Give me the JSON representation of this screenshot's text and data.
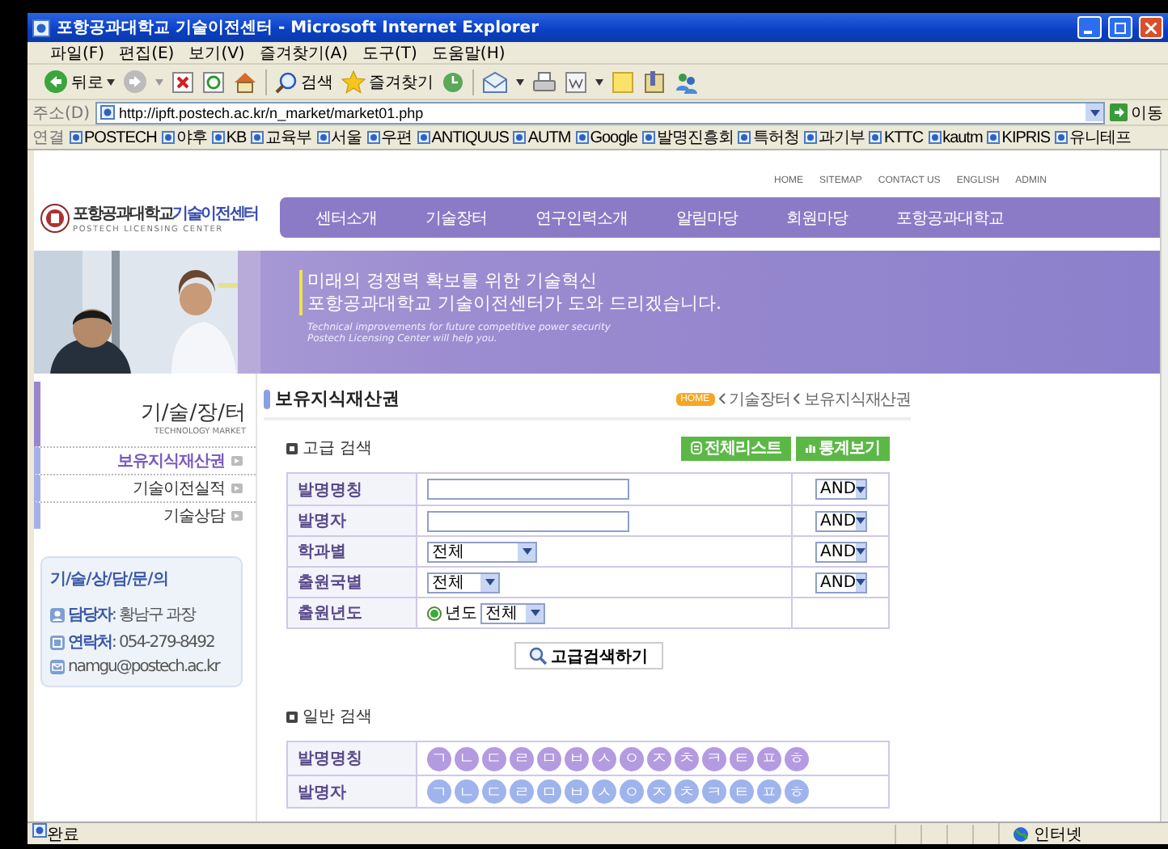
{
  "window": {
    "title": "포항공과대학교 기술이전센터 - Microsoft Internet Explorer"
  },
  "menu": [
    "파일(F)",
    "편집(E)",
    "보기(V)",
    "즐겨찾기(A)",
    "도구(T)",
    "도움말(H)"
  ],
  "toolbar": {
    "back": "뒤로",
    "search": "검색",
    "favorites": "즐겨찾기"
  },
  "address": {
    "label": "주소(D)",
    "url": "http://ipft.postech.ac.kr/n_market/market01.php",
    "go": "이동"
  },
  "links": {
    "label": "연결",
    "items": [
      "POSTECH",
      "야후",
      "KB",
      "교육부",
      "서울",
      "우편",
      "ANTIQUUS",
      "AUTM",
      "Google",
      "발명진흥회",
      "특허청",
      "과기부",
      "KTTC",
      "kautm",
      "KIPRIS",
      "유니테프"
    ]
  },
  "page": {
    "top_links": [
      "HOME",
      "SITEMAP",
      "CONTACT US",
      "ENGLISH",
      "ADMIN"
    ],
    "logo": {
      "name": "포항공과대학교",
      "accent": "기술이전센터",
      "subtitle": "POSTECH LICENSING CENTER"
    },
    "nav": [
      "센터소개",
      "기술장터",
      "연구인력소개",
      "알림마당",
      "회원마당",
      "포항공과대학교"
    ],
    "banner": {
      "headline": [
        "미래의 경쟁력 확보를 위한 기술혁신",
        "포항공과대학교 기술이전센터가 도와 드리겠습니다."
      ],
      "tagline": [
        "Technical improvements for future competitive power security",
        "Postech Licensing Center will help you."
      ]
    },
    "sidebar": {
      "title": "기/술/장/터",
      "subtitle": "TECHNOLOGY MARKET",
      "items": [
        {
          "label": "보유지식재산권",
          "selected": true
        },
        {
          "label": "기술이전실적",
          "selected": false
        },
        {
          "label": "기술상담",
          "selected": false
        }
      ],
      "contact": {
        "title": "기/술/상/담/문/의",
        "rows": [
          {
            "kind": "person",
            "label": "담당자",
            "value": ": 황남구 과장"
          },
          {
            "kind": "phone",
            "label": "연락처",
            "value": ": 054-279-8492"
          },
          {
            "kind": "email",
            "value": "namgu@postech.ac.kr"
          }
        ]
      }
    },
    "content": {
      "title": "보유지식재산권",
      "breadcrumb": {
        "home": "HOME",
        "path": [
          "기술장터",
          "보유지식재산권"
        ]
      },
      "advanced": {
        "title": "고급 검색",
        "buttons": [
          {
            "kind": "list",
            "label": "전체리스트"
          },
          {
            "kind": "stats",
            "label": "통계보기"
          }
        ],
        "rows": [
          {
            "label": "발명명칭",
            "kind": "text",
            "operator": "AND"
          },
          {
            "label": "발명자",
            "kind": "text",
            "operator": "AND"
          },
          {
            "label": "학과별",
            "kind": "select",
            "value": "전체",
            "operator": "AND"
          },
          {
            "label": "출원국별",
            "kind": "select",
            "value": "전체",
            "operator": "AND"
          },
          {
            "label": "출원년도",
            "kind": "year",
            "option": "년도",
            "checked": true,
            "value": "전체"
          }
        ],
        "submit": "고급검색하기"
      },
      "general": {
        "title": "일반 검색",
        "rows": [
          {
            "label": "발명명칭",
            "color": "#b49be0",
            "keys": [
              "ㄱ",
              "ㄴ",
              "ㄷ",
              "ㄹ",
              "ㅁ",
              "ㅂ",
              "ㅅ",
              "ㅇ",
              "ㅈ",
              "ㅊ",
              "ㅋ",
              "ㅌ",
              "ㅍ",
              "ㅎ"
            ]
          },
          {
            "label": "발명자",
            "color": "#9fb4ec",
            "keys": [
              "ㄱ",
              "ㄴ",
              "ㄷ",
              "ㄹ",
              "ㅁ",
              "ㅂ",
              "ㅅ",
              "ㅇ",
              "ㅈ",
              "ㅊ",
              "ㅋ",
              "ㅌ",
              "ㅍ",
              "ㅎ"
            ]
          }
        ]
      }
    }
  },
  "status_bar": {
    "text": "완료",
    "zone": "인터넷"
  }
}
